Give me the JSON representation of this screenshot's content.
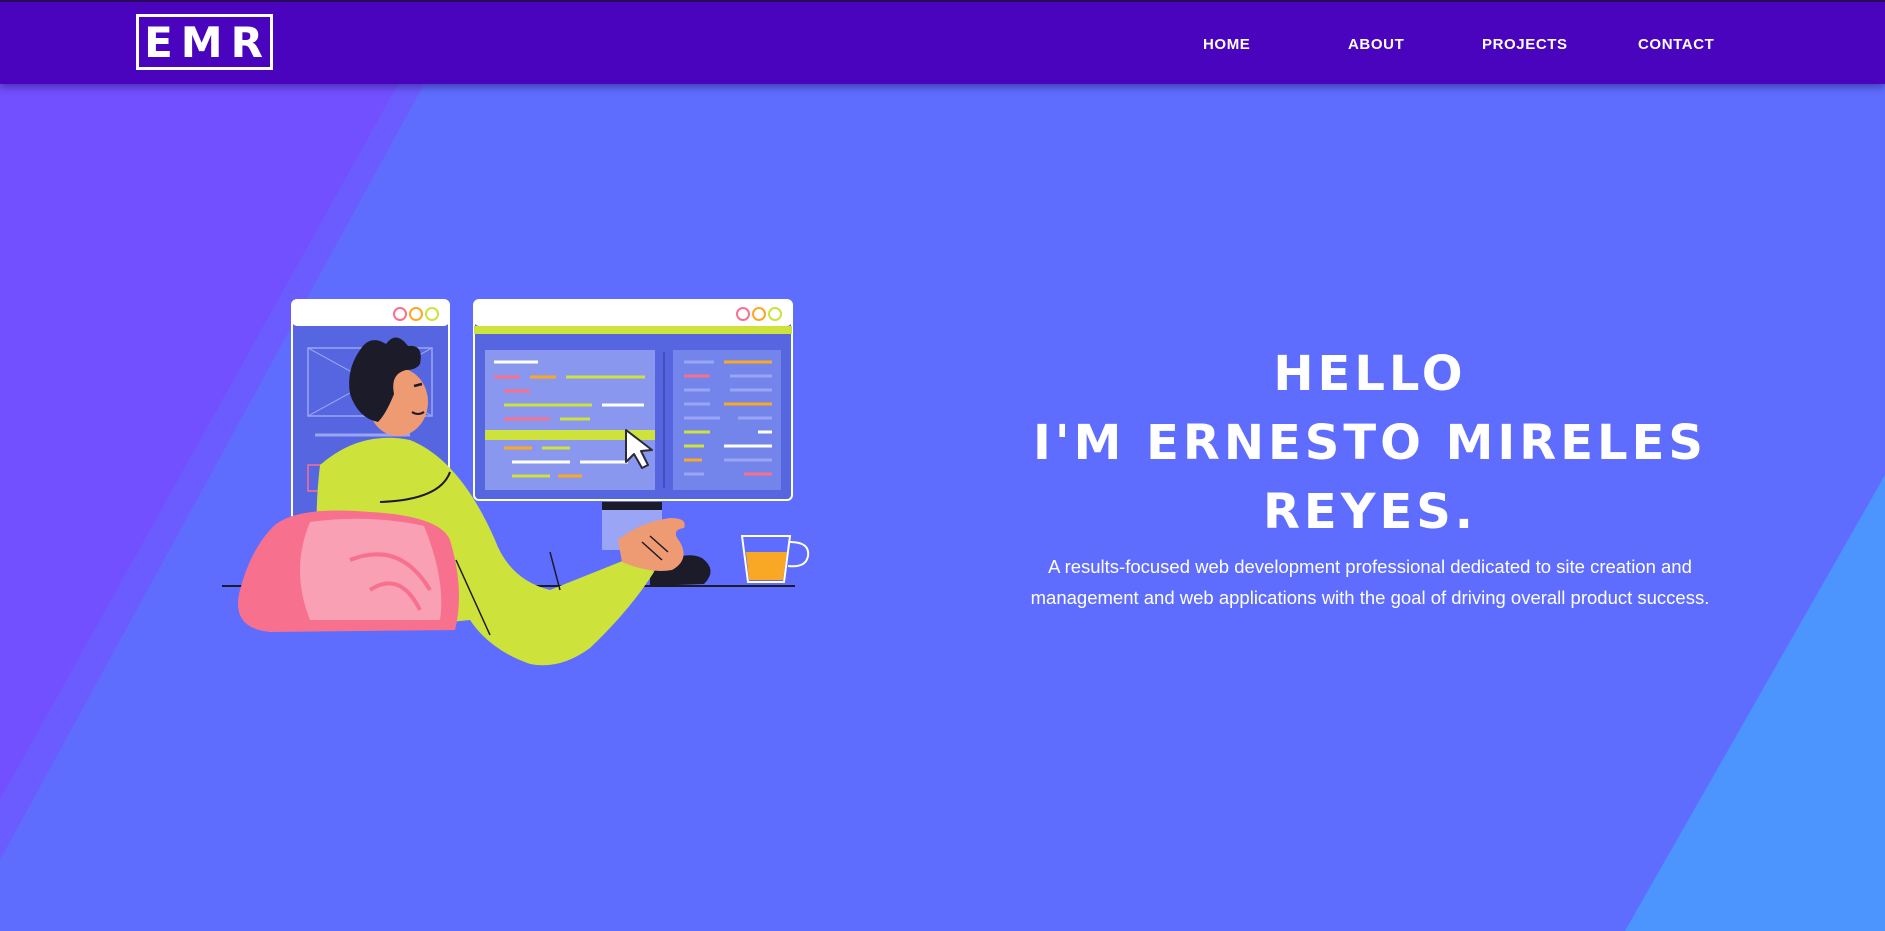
{
  "header": {
    "logo": "EMR",
    "nav": [
      "HOME",
      "ABOUT",
      "PROJECTS",
      "CONTACT"
    ]
  },
  "hero": {
    "line1": "HELLO",
    "line2": "I'M ERNESTO MIRELES",
    "line3": "REYES.",
    "description_line1": "A results-focused web development professional dedicated to site creation and",
    "description_line2": "management and web applications with the goal of driving overall product success."
  },
  "illustration": {
    "icon": "developer-at-computer-icon",
    "accent_yellow": "#cde23a",
    "accent_pink": "#f7718f",
    "accent_orange": "#f9a825"
  },
  "colors": {
    "nav_background": "#4a04bd",
    "page_background": "#5f6dff",
    "left_stripe": "#7250ff",
    "right_stripe": "#4c95ff",
    "text": "#ffffff"
  }
}
